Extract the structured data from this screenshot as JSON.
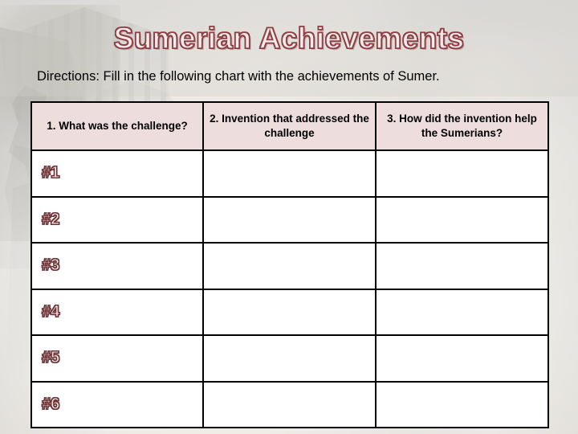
{
  "slide": {
    "title": "Sumerian Achievements",
    "directions": "Directions:  Fill in the following chart with the achievements of Sumer.",
    "colors": {
      "title_outline": "#8e3f43",
      "title_fill": "#f7eceb",
      "header_background": "#eedddd",
      "table_border": "#000000",
      "body_text": "#000000",
      "cell_background": "#ffffff"
    },
    "background": {
      "description": "faded ancient ruins scene",
      "elements": [
        "ruined stone columns",
        "arched structure",
        "temple colonnade",
        "tree canopy",
        "statue silhouette",
        "sky and clouds"
      ]
    }
  },
  "chart": {
    "columns": [
      {
        "id": "challenge",
        "header": "1.  What was the challenge?"
      },
      {
        "id": "invention",
        "header": "2.  Invention that addressed the challenge"
      },
      {
        "id": "benefit",
        "header": "3.  How did the invention help the Sumerians?"
      }
    ],
    "rows": [
      {
        "label": "#1",
        "align": "top",
        "challenge": "",
        "invention": "",
        "benefit": ""
      },
      {
        "label": "#2",
        "align": "middle",
        "challenge": "",
        "invention": "",
        "benefit": ""
      },
      {
        "label": "#3",
        "align": "bottom",
        "challenge": "",
        "invention": "",
        "benefit": ""
      },
      {
        "label": "#4",
        "align": "top",
        "challenge": "",
        "invention": "",
        "benefit": ""
      },
      {
        "label": "#5",
        "align": "middle",
        "challenge": "",
        "invention": "",
        "benefit": ""
      },
      {
        "label": "#6",
        "align": "bottom",
        "challenge": "",
        "invention": "",
        "benefit": ""
      }
    ]
  }
}
